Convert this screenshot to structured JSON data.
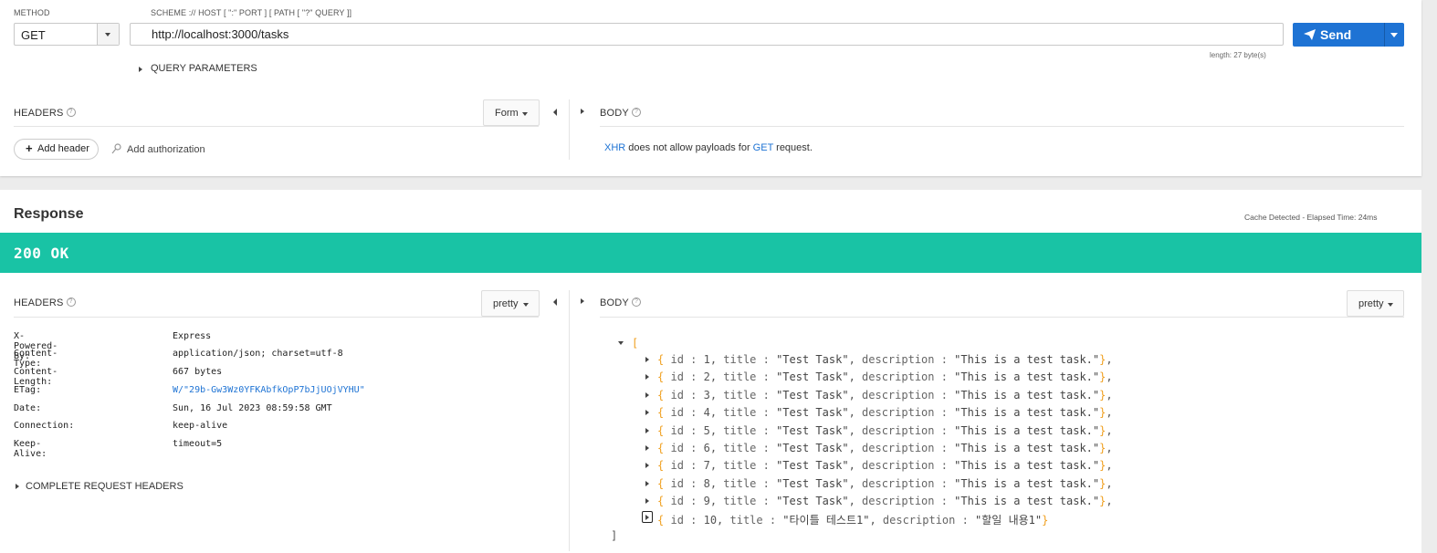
{
  "request": {
    "method_label": "METHOD",
    "method_value": "GET",
    "scheme_label": "SCHEME :// HOST [ \":\" PORT ] [ PATH [ \"?\" QUERY ]]",
    "url": "http://localhost:3000/tasks",
    "send_label": "Send",
    "length_text": "length: 27 byte(s)",
    "query_parameters_label": "QUERY PARAMETERS",
    "headers_title": "HEADERS",
    "headers_mode": "Form",
    "add_header_label": "Add header",
    "add_authorization_label": "Add authorization",
    "body_title": "BODY",
    "body_msg_xhr": "XHR",
    "body_msg_mid": "does not allow payloads for",
    "body_msg_method": "GET",
    "body_msg_end": "request."
  },
  "response": {
    "title": "Response",
    "cache_info": "Cache Detected - Elapsed Time: 24ms",
    "status": "200 OK",
    "headers_title": "HEADERS",
    "headers_mode": "pretty",
    "body_title": "BODY",
    "body_mode": "pretty",
    "headers": [
      {
        "name": "X-Powered-By:",
        "value": "Express"
      },
      {
        "name": "Content-Type:",
        "value": "application/json; charset=utf-8"
      },
      {
        "name": "Content-Length:",
        "value": "667 bytes"
      },
      {
        "name": "ETag:",
        "value": "W/\"29b-Gw3Wz0YFKAbfkOpP7bJjUOjVYHU\""
      },
      {
        "name": "Date:",
        "value": "Sun, 16 Jul 2023 08:59:58 GMT"
      },
      {
        "name": "Connection:",
        "value": "keep-alive"
      },
      {
        "name": "Keep-Alive:",
        "value": "timeout=5"
      }
    ],
    "complete_request_headers_label": "COMPLETE REQUEST HEADERS",
    "json_open": "[",
    "json_close": "]",
    "json_items": [
      {
        "id": "1",
        "title": "\"Test Task\"",
        "description": "\"This is a test task.\""
      },
      {
        "id": "2",
        "title": "\"Test Task\"",
        "description": "\"This is a test task.\""
      },
      {
        "id": "3",
        "title": "\"Test Task\"",
        "description": "\"This is a test task.\""
      },
      {
        "id": "4",
        "title": "\"Test Task\"",
        "description": "\"This is a test task.\""
      },
      {
        "id": "5",
        "title": "\"Test Task\"",
        "description": "\"This is a test task.\""
      },
      {
        "id": "6",
        "title": "\"Test Task\"",
        "description": "\"This is a test task.\""
      },
      {
        "id": "7",
        "title": "\"Test Task\"",
        "description": "\"This is a test task.\""
      },
      {
        "id": "8",
        "title": "\"Test Task\"",
        "description": "\"This is a test task.\""
      },
      {
        "id": "9",
        "title": "\"Test Task\"",
        "description": "\"This is a test task.\""
      },
      {
        "id": "10",
        "title": "\"타이틀 테스트1\"",
        "description": "\"할일 내용1\""
      }
    ]
  },
  "colors": {
    "accent": "#1e73d4",
    "status_ok": "#19c3a5",
    "brace": "#f0a020"
  },
  "icons": {
    "send": "paper-plane-icon",
    "add": "plus-icon",
    "auth": "key-icon",
    "help": "question-circle-icon"
  }
}
